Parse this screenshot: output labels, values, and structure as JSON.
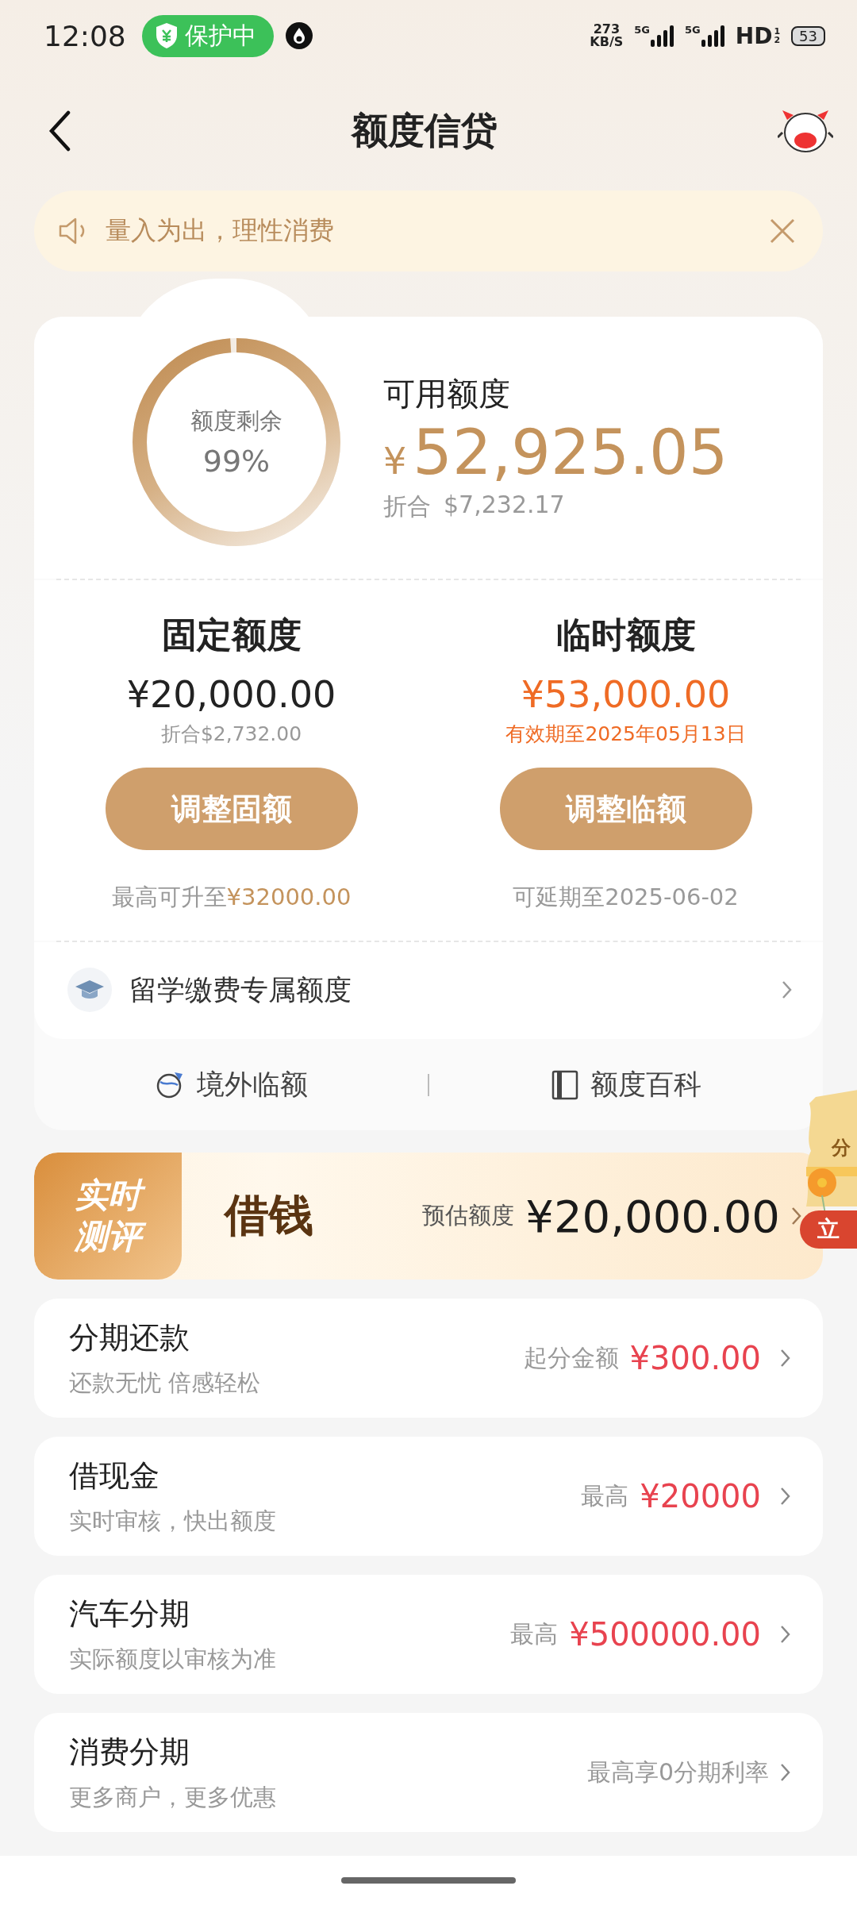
{
  "status_bar": {
    "time": "12:08",
    "shield_badge": "保护中",
    "net_speed_value": "273",
    "net_speed_unit": "KB/S",
    "signals": [
      {
        "label": "5G"
      },
      {
        "label": "5G"
      }
    ],
    "hd": "HD",
    "hd_sub": [
      "1",
      "2"
    ],
    "battery": "53"
  },
  "header": {
    "title": "额度信贷"
  },
  "notice": {
    "text": "量入为出，理性消费"
  },
  "quota_card": {
    "ring": {
      "label": "额度剩余",
      "percent": "99%",
      "level": 0.99
    },
    "available_label": "可用额度",
    "currency": "¥",
    "available_amount": "52,925.05",
    "converted_label": "折合",
    "converted_amount": "$7,232.17",
    "columns": [
      {
        "title": "固定额度",
        "amount": "¥20,000.00",
        "kind": "fixed",
        "note": "折合$2,732.00",
        "button": "调整固额",
        "footer": "最高可升至",
        "footer_highlight": "¥32000.00"
      },
      {
        "title": "临时额度",
        "amount": "¥53,000.00",
        "kind": "temporary",
        "note": "有效期至2025年05月13日",
        "button": "调整临额",
        "footer": "可延期至2025-06-02"
      }
    ],
    "special_row": {
      "label": "留学缴费专属额度"
    },
    "links": [
      {
        "label": "境外临额",
        "kind": "overseas"
      },
      {
        "label": "额度百科",
        "kind": "wiki"
      }
    ]
  },
  "loan_banner": {
    "tag_lines": [
      "实时",
      "测评"
    ],
    "title": "借钱",
    "estimate_label": "预估额度",
    "estimate_amount": "¥20,000.00"
  },
  "float_badge": {
    "top_text": "分",
    "button_text": "立"
  },
  "products": [
    {
      "title": "分期还款",
      "subtitle": "还款无忧 倍感轻松",
      "right_label": "起分金额",
      "right_amount": "¥300.00"
    },
    {
      "title": "借现金",
      "subtitle": "实时审核，快出额度",
      "right_label": "最高",
      "right_amount": "¥20000"
    },
    {
      "title": "汽车分期",
      "subtitle": "实际额度以审核为准",
      "right_label": "最高",
      "right_amount": "¥500000.00"
    },
    {
      "title": "消费分期",
      "subtitle": "更多商户，更多优惠",
      "right_label": "最高享0分期利率"
    }
  ]
}
